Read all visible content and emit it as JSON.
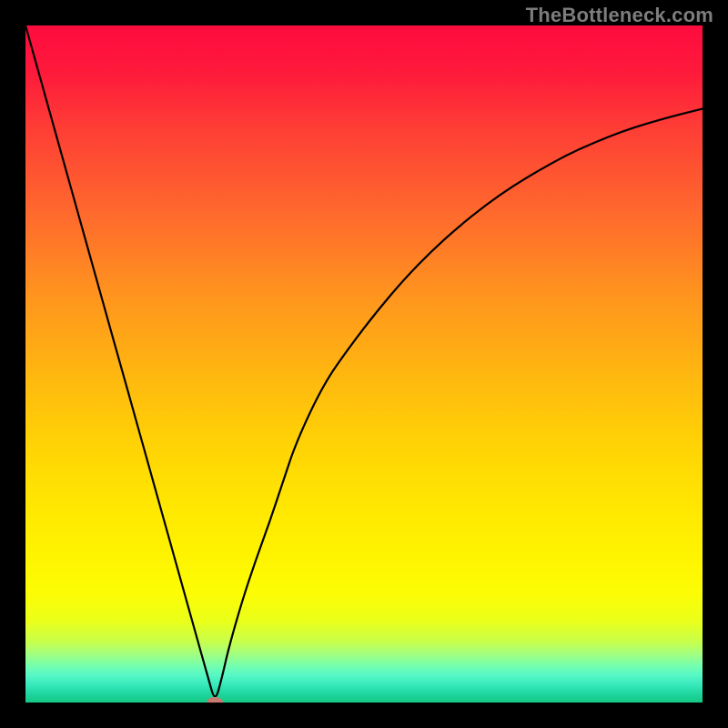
{
  "watermark": "TheBottleneck.com",
  "colors": {
    "frame": "#000000",
    "curve": "#000000",
    "dot": "#c77a6f",
    "gradient_top": "#fd0b3e",
    "gradient_bottom": "#13c984"
  },
  "chart_data": {
    "type": "line",
    "title": "",
    "xlabel": "",
    "ylabel": "",
    "xlim": [
      0,
      100
    ],
    "ylim": [
      0,
      100
    ],
    "grid": false,
    "legend": false,
    "x": [
      0,
      2,
      4,
      6,
      8,
      10,
      12,
      14,
      16,
      18,
      20,
      22,
      24,
      26,
      27,
      28,
      29,
      30,
      32,
      34,
      36,
      38,
      40,
      44,
      48,
      52,
      56,
      60,
      64,
      68,
      72,
      76,
      80,
      84,
      88,
      92,
      96,
      100
    ],
    "values": [
      100,
      92.9,
      85.7,
      78.6,
      71.4,
      64.3,
      57.1,
      50.0,
      42.9,
      35.7,
      28.6,
      21.4,
      14.3,
      7.1,
      3.6,
      0.0,
      3.6,
      8.0,
      15.0,
      21.0,
      26.5,
      32.5,
      38.5,
      47.0,
      52.7,
      57.9,
      62.6,
      66.7,
      70.3,
      73.5,
      76.3,
      78.7,
      80.9,
      82.7,
      84.3,
      85.6,
      86.7,
      87.7
    ],
    "series": [
      {
        "name": "bottleneck-curve",
        "x": [
          0,
          2,
          4,
          6,
          8,
          10,
          12,
          14,
          16,
          18,
          20,
          22,
          24,
          26,
          27,
          28,
          29,
          30,
          32,
          34,
          36,
          38,
          40,
          44,
          48,
          52,
          56,
          60,
          64,
          68,
          72,
          76,
          80,
          84,
          88,
          92,
          96,
          100
        ],
        "y": [
          100,
          92.9,
          85.7,
          78.6,
          71.4,
          64.3,
          57.1,
          50.0,
          42.9,
          35.7,
          28.6,
          21.4,
          14.3,
          7.1,
          3.6,
          0.0,
          3.6,
          8.0,
          15.0,
          21.0,
          26.5,
          32.5,
          38.5,
          47.0,
          52.7,
          57.9,
          62.6,
          66.7,
          70.3,
          73.5,
          76.3,
          78.7,
          80.9,
          82.7,
          84.3,
          85.6,
          86.7,
          87.7
        ]
      }
    ],
    "marker": {
      "x": 28,
      "y": 0
    },
    "annotations": []
  }
}
